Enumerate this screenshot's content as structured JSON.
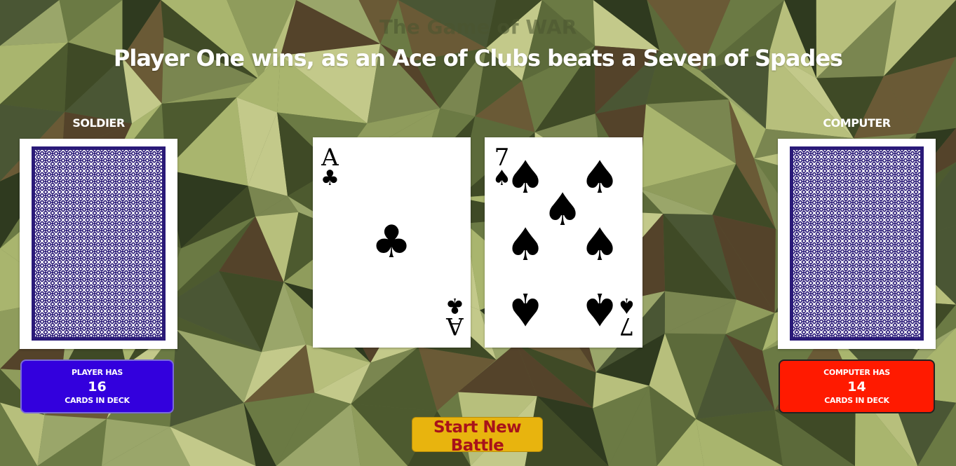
{
  "header": {
    "title": "The Game of WAR",
    "message": "Player One wins, as an Ace of Clubs beats a Seven of Spades"
  },
  "player": {
    "label": "SOLDIER",
    "counter_line1": "PLAYER HAS",
    "count": "16",
    "counter_line2": "CARDS IN DECK",
    "color": "#3300dd"
  },
  "computer": {
    "label": "COMPUTER",
    "counter_line1": "COMPUTER HAS",
    "count": "14",
    "counter_line2": "CARDS IN DECK",
    "color": "#ff1a00"
  },
  "played_cards": {
    "player_card": {
      "rank": "A",
      "suit": "♣"
    },
    "computer_card": {
      "rank": "7",
      "suit": "♠"
    }
  },
  "actions": {
    "start_label": "Start New Battle"
  },
  "colors": {
    "card_back": "#2a1a78",
    "button_bg": "#e8b40e",
    "button_text": "#a8121a"
  }
}
